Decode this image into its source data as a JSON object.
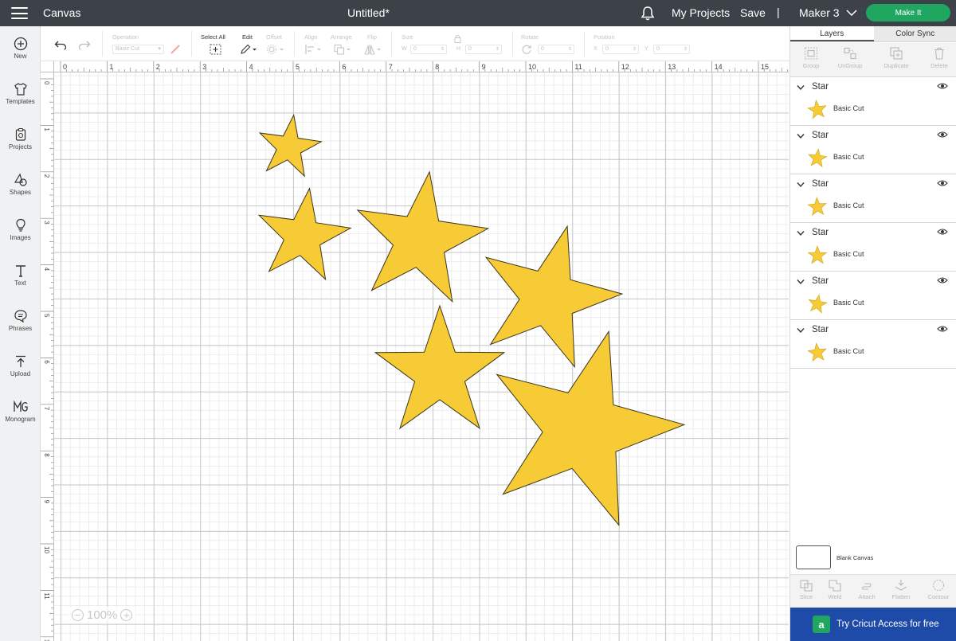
{
  "topbar": {
    "app_title": "Canvas",
    "doc_title": "Untitled*",
    "my_projects": "My Projects",
    "save": "Save",
    "separator": "|",
    "machine": "Maker 3",
    "make_it": "Make It"
  },
  "sidebar": {
    "items": [
      {
        "label": "New",
        "icon": "plus-circle-icon"
      },
      {
        "label": "Templates",
        "icon": "shirt-icon"
      },
      {
        "label": "Projects",
        "icon": "clipboard-icon"
      },
      {
        "label": "Shapes",
        "icon": "shapes-icon"
      },
      {
        "label": "Images",
        "icon": "lightbulb-icon"
      },
      {
        "label": "Text",
        "icon": "text-icon"
      },
      {
        "label": "Phrases",
        "icon": "speech-bubble-icon"
      },
      {
        "label": "Upload",
        "icon": "upload-icon"
      },
      {
        "label": "Monogram",
        "icon": "monogram-icon"
      }
    ]
  },
  "toolbar": {
    "operation_label": "Operation",
    "operation_value": "Basic Cut",
    "select_all_label": "Select All",
    "edit_label": "Edit",
    "offset_label": "Offset",
    "align_label": "Align",
    "arrange_label": "Arrange",
    "flip_label": "Flip",
    "size_label": "Size",
    "w_label": "W",
    "w_value": "0",
    "h_label": "H",
    "h_value": "0",
    "rotate_label": "Rotate",
    "rotate_value": "0",
    "position_label": "Position",
    "x_label": "X",
    "x_value": "0",
    "y_label": "Y",
    "y_value": "0"
  },
  "ruler": {
    "top": [
      "0",
      "1",
      "2",
      "3",
      "4",
      "5",
      "6",
      "7",
      "8",
      "9",
      "10",
      "11",
      "12",
      "13",
      "14",
      "15"
    ],
    "left": [
      "0",
      "1",
      "2",
      "3",
      "4",
      "5",
      "6",
      "7",
      "8",
      "9",
      "10",
      "11",
      "12"
    ]
  },
  "canvas": {
    "zoom": "100%",
    "star_color": "#F7CB35",
    "star_stroke": "#3a3520"
  },
  "panel": {
    "tabs": [
      "Layers",
      "Color Sync"
    ],
    "actions": [
      "Group",
      "UnGroup",
      "Duplicate",
      "Delete"
    ],
    "layers": [
      {
        "name": "Star",
        "operation": "Basic Cut"
      },
      {
        "name": "Star",
        "operation": "Basic Cut"
      },
      {
        "name": "Star",
        "operation": "Basic Cut"
      },
      {
        "name": "Star",
        "operation": "Basic Cut"
      },
      {
        "name": "Star",
        "operation": "Basic Cut"
      },
      {
        "name": "Star",
        "operation": "Basic Cut"
      }
    ],
    "blank_canvas": "Blank Canvas",
    "bottom_actions": [
      "Slice",
      "Weld",
      "Attach",
      "Flatten",
      "Contour"
    ],
    "access_text": "Try Cricut Access for free",
    "access_logo": "a"
  }
}
